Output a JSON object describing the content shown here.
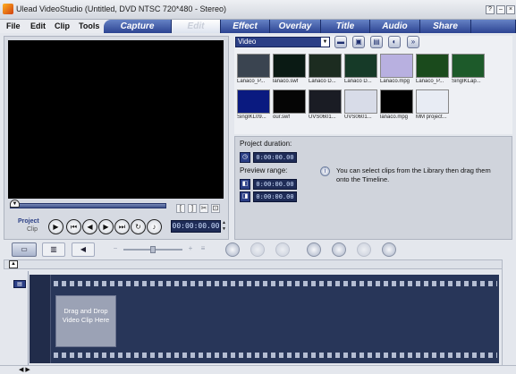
{
  "window": {
    "title": "Ulead VideoStudio (Untitled, DVD NTSC 720*480 - Stereo)"
  },
  "menu": [
    "File",
    "Edit",
    "Clip",
    "Tools"
  ],
  "tabs": [
    "Capture",
    "Edit",
    "Effect",
    "Overlay",
    "Title",
    "Audio",
    "Share"
  ],
  "active_tab": "Edit",
  "preview": {
    "mode_project": "Project",
    "mode_clip": "Clip",
    "timecode": "00:00:00.00"
  },
  "library": {
    "category": "Video",
    "clips": [
      {
        "label": "Lanaco_P...",
        "color": "#3a4450"
      },
      {
        "label": "lanaco.swf",
        "color": "#0a1a14"
      },
      {
        "label": "Lanaco D...",
        "color": "#1c2c20"
      },
      {
        "label": "Lanaco D...",
        "color": "#163a28"
      },
      {
        "label": "Lanaco.mpg",
        "color": "#b8b0e0"
      },
      {
        "label": "Lanaco_P...",
        "color": "#1a4a1c"
      },
      {
        "label": "SingIKLap...",
        "color": "#1d5a2a"
      },
      {
        "label": "SingIKL09...",
        "color": "#0a1a80"
      },
      {
        "label": "our.swf",
        "color": "#050505"
      },
      {
        "label": "UVS0601...",
        "color": "#1a1c24"
      },
      {
        "label": "UVS0601...",
        "color": "#d8dce8"
      },
      {
        "label": "lanaco.mpg",
        "color": "#000000"
      },
      {
        "label": "MM project...",
        "color": "#e8ecf4"
      }
    ]
  },
  "options": {
    "project_duration_label": "Project duration:",
    "project_duration": "0:00:00.00",
    "preview_range_label": "Preview range:",
    "range_start": "0:00:00.00",
    "range_end": "0:00:00.00",
    "hint": "You can select clips from the Library then drag them onto the Timeline."
  },
  "timeline": {
    "drop_text": "Drag and Drop Video Clip Here"
  },
  "colors": {
    "accent": "#2b3f86",
    "tab_gradient_top": "#6682c5",
    "film_bg": "#283659"
  }
}
